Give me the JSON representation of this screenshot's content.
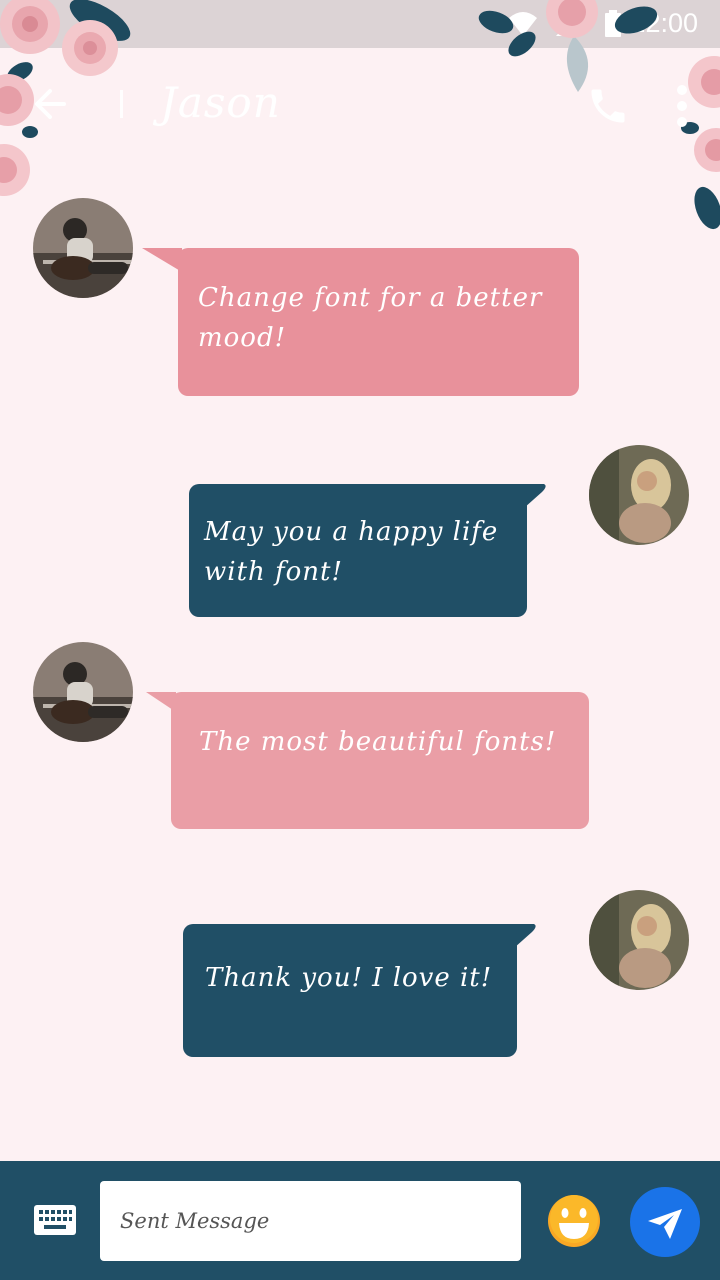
{
  "status_bar": {
    "time": "12:00"
  },
  "app_bar": {
    "title": "Jason"
  },
  "colors": {
    "background": "#fdf1f3",
    "incoming_bubble": "#e8919b",
    "incoming_bubble_alt": "#ea9ea6",
    "outgoing_bubble": "#204f66",
    "input_bar": "#204f66",
    "send_button": "#1a73e8",
    "emoji": "#f9a825"
  },
  "messages": [
    {
      "direction": "incoming",
      "text": "Change font for a better mood!"
    },
    {
      "direction": "outgoing",
      "text": "May you a happy life with font!"
    },
    {
      "direction": "incoming",
      "text": "The most beautiful fonts!"
    },
    {
      "direction": "outgoing",
      "text": "Thank you!  I love it!"
    }
  ],
  "input": {
    "placeholder": "Sent Message"
  },
  "icons": [
    "wifi-icon",
    "signal-icon",
    "battery-icon",
    "back-arrow-icon",
    "phone-icon",
    "more-vert-icon",
    "keyboard-icon",
    "emoji-icon",
    "send-icon"
  ]
}
